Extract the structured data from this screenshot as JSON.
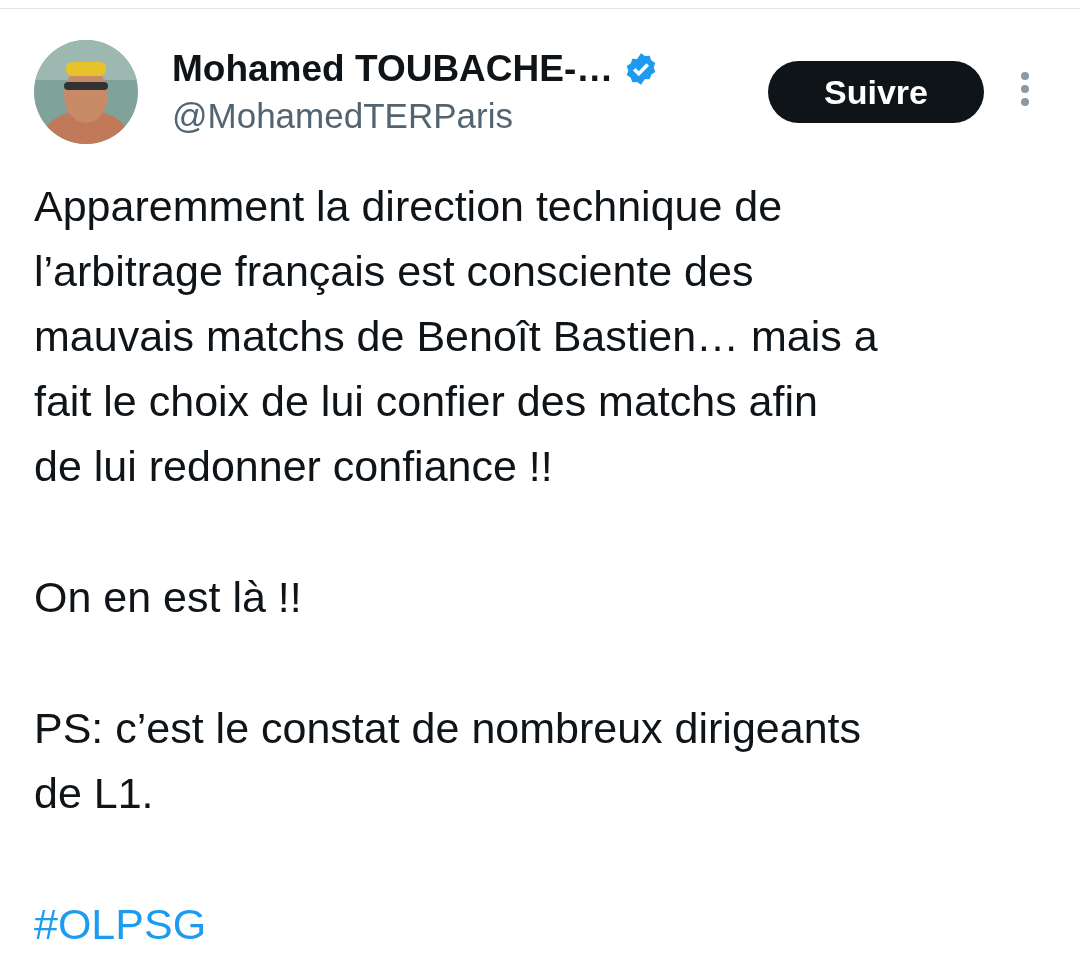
{
  "author": {
    "name": "Mohamed TOUBACHE-…",
    "handle": "@MohamedTERParis",
    "verified": true
  },
  "follow_button": "Suivre",
  "paragraphs": [
    {
      "kind": "text",
      "lines": [
        "Apparemment la direction technique de",
        "l’arbitrage français est consciente des",
        "mauvais matchs de Benoît Bastien… mais a",
        "fait le choix de lui confier des matchs afin",
        "de lui redonner confiance !!"
      ]
    },
    {
      "kind": "text",
      "lines": [
        "On en est là !!"
      ]
    },
    {
      "kind": "text",
      "lines": [
        "PS: c’est le constat de nombreux dirigeants",
        "de L1."
      ]
    },
    {
      "kind": "hashtag",
      "lines": [
        "#OLPSG"
      ]
    }
  ]
}
